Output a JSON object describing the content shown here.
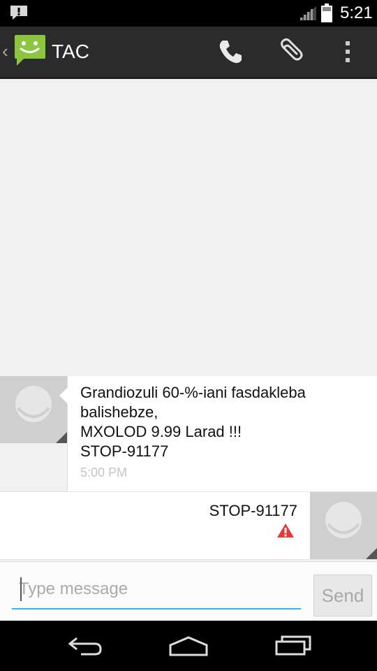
{
  "status_bar": {
    "time": "5:21",
    "icons": [
      "notification-alert-icon",
      "signal-icon",
      "battery-icon"
    ]
  },
  "action_bar": {
    "title": "TAC",
    "icons": [
      "back-caret-icon",
      "messaging-app-icon",
      "phone-icon",
      "attach-icon",
      "overflow-menu-icon"
    ]
  },
  "messages": [
    {
      "direction": "incoming",
      "text": "Grandiozuli 60-%-iani fasdakleba\nbalishebze,\nMXOLOD 9.99 Larad !!!\nSTOP-91177",
      "timestamp": "5:00 PM"
    },
    {
      "direction": "outgoing",
      "text": "STOP-91177",
      "status_icon": "warning-icon"
    }
  ],
  "compose": {
    "placeholder": "Type message",
    "send_label": "Send"
  },
  "colors": {
    "accent": "#33b5e5",
    "app_green": "#8cc63e",
    "warning": "#e53935"
  }
}
